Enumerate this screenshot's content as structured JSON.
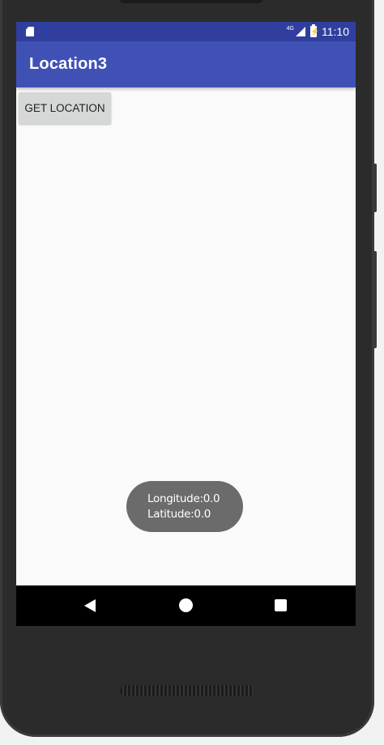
{
  "status_bar": {
    "network": "4G",
    "time": "11:10"
  },
  "app_bar": {
    "title": "Location3"
  },
  "main": {
    "get_location_label": "GET LOCATION"
  },
  "toast": {
    "longitude": "Longitude:0.0",
    "latitude": "Latitude:0.0"
  },
  "colors": {
    "status_bar": "#303f9f",
    "app_bar": "#3f51b5",
    "toast": "#6b6b6b"
  }
}
